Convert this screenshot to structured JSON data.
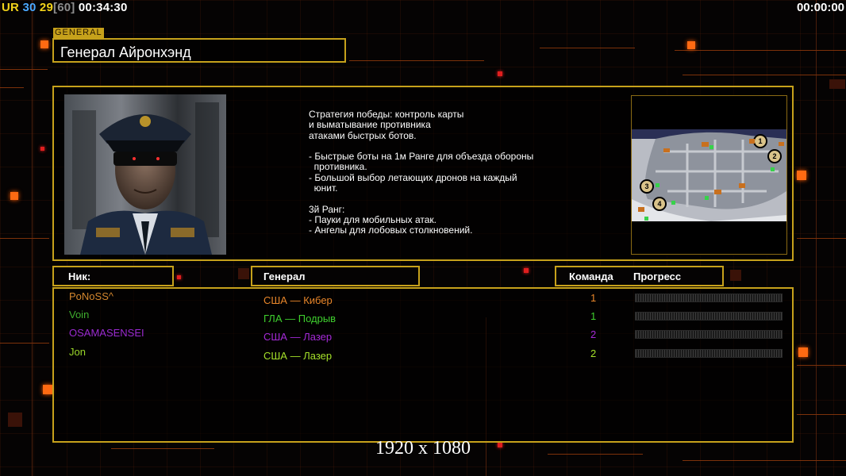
{
  "hud": {
    "ur": "UR",
    "n1": "30",
    "n2": "29",
    "n3": "[60]",
    "clock_left": "00:34:30",
    "clock_right": "00:00:00"
  },
  "general": {
    "tag": "GENERAL",
    "name": "Генерал Айронхэнд",
    "description": "Стратегия победы: контроль карты\nи выматывание противника\nатаками быстрых ботов.\n\n- Быстрые боты на 1м Ранге для объезда обороны\n  противника.\n- Большой выбор летающих дронов на каждый\n  юнит.\n\n3й Ранг:\n- Пауки для мобильных атак.\n- Ангелы для лобовых столкновений."
  },
  "map": {
    "spawns": [
      "1",
      "2",
      "3",
      "4"
    ]
  },
  "headers": {
    "nick": "Ник:",
    "general": "Генерал",
    "team": "Команда",
    "progress": "Прогресс"
  },
  "players": [
    {
      "nick": "PoNoSS^",
      "general": "США — Кибер",
      "team": "1",
      "progress": 0,
      "nick_color": "#d4872e",
      "general_color": "#e8862a",
      "team_color": "#e8862a"
    },
    {
      "nick": "Voin",
      "general": "ГЛА — Подрыв",
      "team": "1",
      "progress": 0,
      "nick_color": "#3fae2e",
      "general_color": "#3fcf2e",
      "team_color": "#3fcf2e"
    },
    {
      "nick": "OSAMASENSEI",
      "general": "США — Лазер",
      "team": "2",
      "progress": 0,
      "nick_color": "#9a2ad0",
      "general_color": "#a52ad8",
      "team_color": "#a52ad8"
    },
    {
      "nick": "Jon",
      "general": "США — Лазер",
      "team": "2",
      "progress": 0,
      "nick_color": "#9bd82a",
      "general_color": "#a6e22a",
      "team_color": "#a6e22a"
    }
  ],
  "footer": {
    "resolution": "1920 x 1080"
  },
  "colors": {
    "accent_gold": "#c6a11b",
    "accent_orange": "#ff6a12"
  }
}
